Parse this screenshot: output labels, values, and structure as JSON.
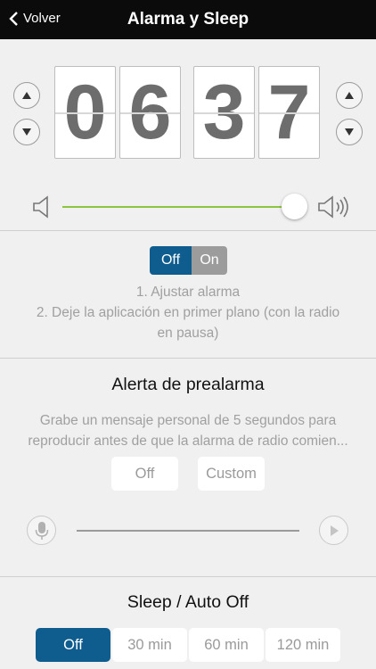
{
  "nav": {
    "back_label": "Volver",
    "title": "Alarma y Sleep"
  },
  "alarm_time": {
    "digits": [
      "0",
      "6",
      "3",
      "7"
    ],
    "hours": "06",
    "minutes": "37"
  },
  "volume": {
    "level": 0.94,
    "accent_color": "#8cc63f"
  },
  "alarm_toggle": {
    "off_label": "Off",
    "on_label": "On",
    "selected": "Off"
  },
  "instructions": {
    "line1": "1. Ajustar alarma",
    "line2": "2. Deje la aplicación en primer plano (con la radio",
    "line3": "en pausa)"
  },
  "prealarm": {
    "title": "Alerta de prealarma",
    "desc_line1": "Grabe un mensaje personal de 5 segundos para",
    "desc_line2": "reproducir antes de que la alarma de radio comien...",
    "options": [
      "Off",
      "Custom"
    ]
  },
  "sleep": {
    "title": "Sleep / Auto Off",
    "options": [
      "Off",
      "30 min",
      "60 min",
      "120 min"
    ],
    "selected": "Off"
  },
  "colors": {
    "selected_blue": "#0f5c8f",
    "toggle_gray": "#9c9c9c",
    "nav_bg": "#0b0b0b"
  }
}
